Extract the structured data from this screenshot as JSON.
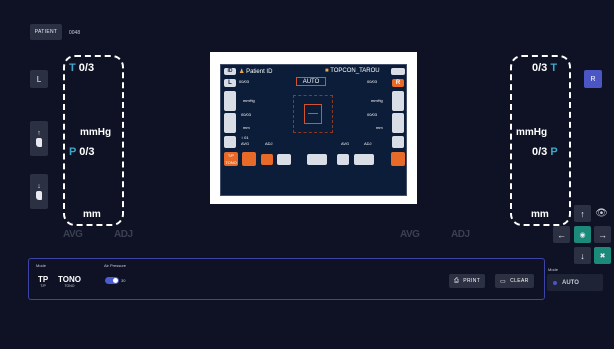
{
  "header": {
    "patient_label": "PATIENT",
    "patient_number": "0048"
  },
  "left": {
    "side_label": "L",
    "tonometry": "0/3",
    "tono_prefix": "T",
    "unit_pressure": "mmHg",
    "pachy": "0/3",
    "pachy_prefix": "P",
    "unit_thickness": "mm",
    "avg": "AVG",
    "adj": "ADJ"
  },
  "right": {
    "side_label": "R",
    "tonometry": "0/3",
    "tono_prefix": "T",
    "unit_pressure": "mmHg",
    "pachy": "0/3",
    "pachy_prefix": "P",
    "unit_thickness": "mm",
    "avg": "AVG",
    "adj": "ADJ"
  },
  "camera_screen": {
    "id_label": "ID",
    "patient_id_label": "Patient ID",
    "device_name": "TOPCON_TAROU",
    "auto_label": "AUTO",
    "l_label": "L",
    "r_label": "R",
    "left_val1": "00/03",
    "right_val1": "00/03",
    "mmhg_left": "mmHg",
    "mmhg_right": "mmHg",
    "left_val2": "00/03",
    "right_val2": "00/03",
    "mm_left": "mm",
    "mm_right": "mm",
    "avg1": "AVG",
    "adj1": "ADJ",
    "avg2": "AVG",
    "adj2": "ADJ",
    "count": "01",
    "tp_label": "T/P",
    "tp_sub": "TONO"
  },
  "controls": {
    "up": "↑",
    "left": "←",
    "right": "→",
    "down": "↓"
  },
  "panel": {
    "mode_label": "Mode",
    "mode_value": "TP",
    "mode_sub": "T/P",
    "mode_value2": "TONO",
    "mode_sub2": "TONO",
    "air_pressure_label": "Air Pressure",
    "air_pressure_value": "30",
    "print_label": "PRINT",
    "clear_label": "CLEAR"
  },
  "right_mode": {
    "label": "Mode",
    "value": "AUTO"
  },
  "colors": {
    "accent_blue": "#4b55c4",
    "teal": "#3fa7c9",
    "green": "#1c8a7a",
    "orange": "#e86a28"
  }
}
